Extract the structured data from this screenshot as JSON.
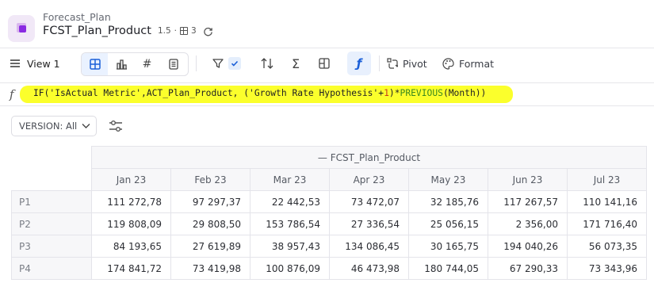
{
  "header": {
    "breadcrumb": "Forecast_Plan",
    "title": "FCST_Plan_Product",
    "version": "1.5",
    "views_count": "3"
  },
  "toolbar": {
    "view_label": "View 1",
    "pivot_label": "Pivot",
    "format_label": "Format"
  },
  "formula": {
    "part1": "IF('IsActual Metric',ACT_Plan_Product, ('Growth Rate Hypothesis'+",
    "num": "1",
    "part2": ")*",
    "fn": "PREVIOUS",
    "part3": "(Month))"
  },
  "filter": {
    "version_label": "VERSION: All"
  },
  "table": {
    "group_header": "— FCST_Plan_Product",
    "months": [
      "Jan 23",
      "Feb 23",
      "Mar 23",
      "Apr 23",
      "May 23",
      "Jun 23",
      "Jul 23"
    ],
    "rows": [
      {
        "label": "P1",
        "values": [
          "111 272,78",
          "97 297,37",
          "22 442,53",
          "73 472,07",
          "32 185,76",
          "117 267,57",
          "110 141,16"
        ]
      },
      {
        "label": "P2",
        "values": [
          "119 808,09",
          "29 808,50",
          "153 786,54",
          "27 336,54",
          "25 056,15",
          "2 356,00",
          "171 716,40"
        ]
      },
      {
        "label": "P3",
        "values": [
          "84 193,65",
          "27 619,89",
          "38 957,43",
          "134 086,45",
          "30 165,75",
          "194 040,26",
          "56 073,35"
        ]
      },
      {
        "label": "P4",
        "values": [
          "174 841,72",
          "73 419,98",
          "100 876,09",
          "46 473,98",
          "180 744,05",
          "67 290,33",
          "73 343,96"
        ]
      }
    ]
  },
  "colors": {
    "accent": "#1a5fd8",
    "highlight": "#fbff2c",
    "app_icon": "#8a2be2"
  }
}
